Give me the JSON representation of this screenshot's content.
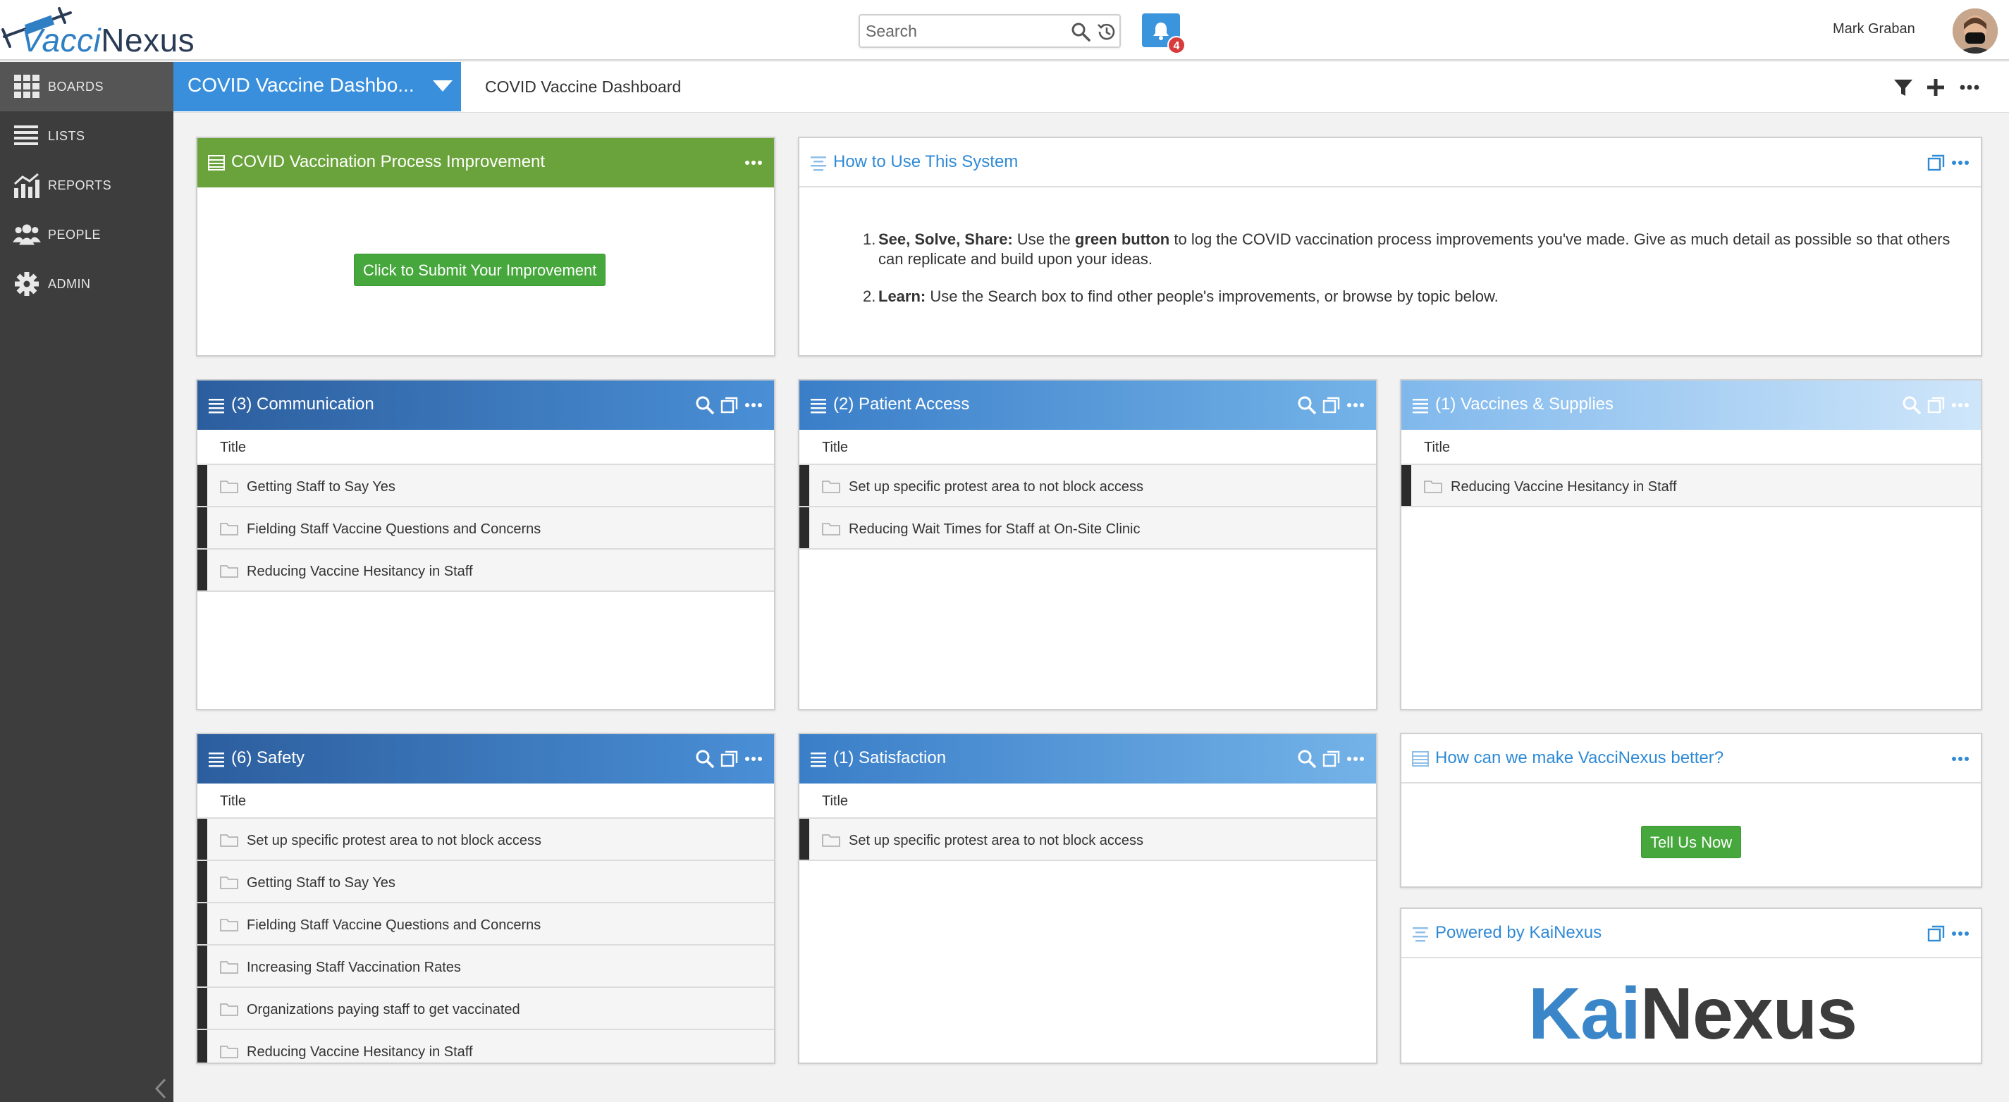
{
  "app": {
    "logo_text_a": "Vacci",
    "logo_text_b": "Nexus",
    "search_placeholder": "Search",
    "notification_count": "4",
    "user_name": "Mark Graban"
  },
  "sidebar": {
    "items": [
      {
        "label": "BOARDS",
        "icon": "boards-grid-icon",
        "active": true
      },
      {
        "label": "LISTS",
        "icon": "lists-icon",
        "active": false
      },
      {
        "label": "REPORTS",
        "icon": "reports-chart-icon",
        "active": false
      },
      {
        "label": "PEOPLE",
        "icon": "people-icon",
        "active": false
      },
      {
        "label": "ADMIN",
        "icon": "gear-icon",
        "active": false
      }
    ]
  },
  "board": {
    "selector_label": "COVID Vaccine Dashbo...",
    "title": "COVID Vaccine Dashboard"
  },
  "widgets": {
    "improvement": {
      "title": "COVID Vaccination Process Improvement",
      "button": "Click to Submit Your Improvement"
    },
    "howto": {
      "title": "How to Use This System",
      "item1_num": "1.",
      "item1_bold1": "See, Solve, Share:",
      "item1_text1": " Use the ",
      "item1_bold2": "green button",
      "item1_text2": " to log the COVID vaccination process improvements you've made. Give as much detail as possible so that others can replicate and build upon your ideas.",
      "item2_num": "2.",
      "item2_bold": "Learn:",
      "item2_text": " Use the Search box to find other people's improvements, or browse by topic below."
    },
    "communication": {
      "title": "(3) Communication",
      "column": "Title",
      "rows": [
        "Getting Staff to Say Yes",
        "Fielding Staff Vaccine Questions and Concerns",
        "Reducing Vaccine Hesitancy in Staff"
      ]
    },
    "patient_access": {
      "title": "(2) Patient Access",
      "column": "Title",
      "rows": [
        "Set up specific protest area to not block access",
        "Reducing Wait Times for Staff at On-Site Clinic"
      ]
    },
    "vaccines": {
      "title": "(1) Vaccines & Supplies",
      "column": "Title",
      "rows": [
        "Reducing Vaccine Hesitancy in Staff"
      ]
    },
    "safety": {
      "title": "(6) Safety",
      "column": "Title",
      "rows": [
        "Set up specific protest area to not block access",
        "Getting Staff to Say Yes",
        "Fielding Staff Vaccine Questions and Concerns",
        "Increasing Staff Vaccination Rates",
        "Organizations paying staff to get vaccinated",
        "Reducing Vaccine Hesitancy in Staff"
      ]
    },
    "satisfaction": {
      "title": "(1) Satisfaction",
      "column": "Title",
      "rows": [
        "Set up specific protest area to not block access"
      ]
    },
    "feedback": {
      "title": "How can we make VacciNexus better?",
      "button": "Tell Us Now"
    },
    "powered": {
      "title": "Powered by KaiNexus",
      "logo_a": "Kai",
      "logo_b": "Nexus"
    }
  },
  "colors": {
    "accent_blue": "#3a8fdc",
    "green": "#6aa33b",
    "button_green": "#46a83c",
    "sidebar": "#3d3d3d"
  }
}
